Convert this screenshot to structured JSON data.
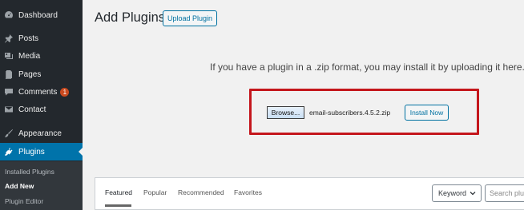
{
  "sidebar": {
    "items": [
      {
        "label": "Dashboard",
        "icon": "dashboard-icon"
      },
      {
        "label": "Posts",
        "icon": "pin-icon"
      },
      {
        "label": "Media",
        "icon": "media-icon"
      },
      {
        "label": "Pages",
        "icon": "pages-icon"
      },
      {
        "label": "Comments",
        "icon": "comment-icon",
        "badge": "1"
      },
      {
        "label": "Contact",
        "icon": "mail-icon"
      },
      {
        "label": "Appearance",
        "icon": "brush-icon"
      },
      {
        "label": "Plugins",
        "icon": "plugin-icon",
        "active": true
      }
    ],
    "submenu": [
      {
        "label": "Installed Plugins"
      },
      {
        "label": "Add New",
        "current": true
      },
      {
        "label": "Plugin Editor"
      }
    ]
  },
  "header": {
    "title": "Add Plugins",
    "upload_label": "Upload Plugin"
  },
  "upload": {
    "hint": "If you have a plugin in a .zip format, you may install it by uploading it here.",
    "browse_label": "Browse...",
    "file_name": "email-subscribers.4.5.2.zip",
    "install_label": "Install Now"
  },
  "filter": {
    "tabs": [
      {
        "label": "Featured",
        "current": true
      },
      {
        "label": "Popular"
      },
      {
        "label": "Recommended"
      },
      {
        "label": "Favorites"
      }
    ],
    "select_value": "Keyword",
    "search_placeholder": "Search plug"
  },
  "colors": {
    "sidebar_bg": "#23282d",
    "active_bg": "#0073aa",
    "highlight_border": "#c4161c",
    "badge": "#ca4a1f"
  }
}
